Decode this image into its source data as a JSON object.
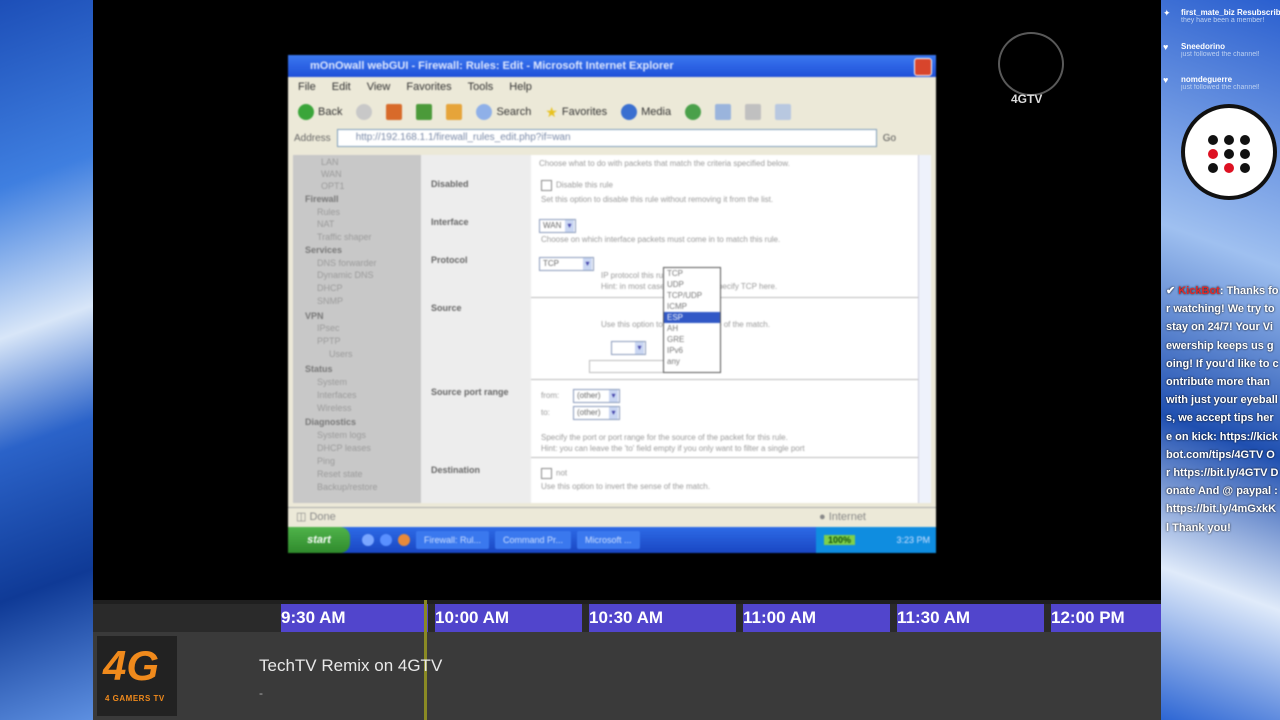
{
  "browser": {
    "title": "mOnOwall webGUI - Firewall: Rules: Edit - Microsoft Internet Explorer",
    "menu": [
      "File",
      "Edit",
      "View",
      "Favorites",
      "Tools",
      "Help"
    ],
    "toolbar": {
      "back": "Back",
      "search": "Search",
      "favorites": "Favorites",
      "media": "Media"
    },
    "address_label": "Address",
    "address": "http://192.168.1.1/firewall_rules_edit.php?if=wan",
    "go": "Go",
    "status_left": "Done",
    "status_right": "Internet"
  },
  "leftnav": {
    "items": [
      "LAN",
      "WAN",
      "OPT1",
      "Firewall",
      "Rules",
      "NAT",
      "Traffic shaper",
      "Services",
      "DNS forwarder",
      "Dynamic DNS",
      "DHCP",
      "SNMP",
      "VPN",
      "IPsec",
      "PPTP",
      "Users",
      "Status",
      "System",
      "Interfaces",
      "Wireless",
      "Diagnostics",
      "System logs",
      "DHCP leases",
      "Ping",
      "Reset state",
      "Backup/restore"
    ]
  },
  "form": {
    "intro": "Choose what to do with packets that match the criteria specified below.",
    "disabled_label": "Disabled",
    "disabled_check": "Disable this rule",
    "disabled_desc": "Set this option to disable this rule without removing it from the list.",
    "interface_label": "Interface",
    "interface_value": "WAN",
    "interface_desc": "Choose on which interface packets must come in to match this rule.",
    "protocol_label": "Protocol",
    "protocol_value": "TCP",
    "protocol_desc1": "IP protocol this rule should match.",
    "protocol_desc2": "Hint: in most cases, you should specify TCP here.",
    "protocol_options": [
      "TCP",
      "UDP",
      "TCP/UDP",
      "ICMP",
      "ESP",
      "AH",
      "GRE",
      "IPv6",
      "any"
    ],
    "protocol_highlight": 4,
    "source_label": "Source",
    "source_desc": "Use this option to invert the sense of the match.",
    "source_port_label": "Source port range",
    "from_label": "from:",
    "to_label": "to:",
    "port_value": "(other)",
    "port_desc1": "Specify the port or port range for the source of the packet for this rule.",
    "port_desc2": "Hint: you can leave the 'to' field empty if you only want to filter a single port",
    "destination_label": "Destination",
    "destination_check": "not",
    "destination_desc": "Use this option to invert the sense of the match."
  },
  "taskbar": {
    "start": "start",
    "tasks": [
      "Firewall: Rul...",
      "Command Pr...",
      "Microsoft ..."
    ],
    "tray_badge": "100%",
    "clock": "3:23 PM"
  },
  "watermark": "4GTV",
  "schedule": {
    "times": [
      "9:30 AM",
      "10:00 AM",
      "10:30 AM",
      "11:00 AM",
      "11:30 AM",
      "12:00 PM"
    ],
    "now_title": "TechTV Remix on 4GTV",
    "now_sub": "-",
    "logo_text": "4G",
    "logo_sub": "4 GAMERS TV"
  },
  "chat": {
    "events": [
      {
        "user": "first_mate_biz Resubscribed",
        "msg": "they have been a member!"
      },
      {
        "user": "Sneedorino",
        "msg": "just followed the channel!"
      },
      {
        "user": "nomdeguerre",
        "msg": "just followed the channel!"
      }
    ],
    "bot_name": "KickBot",
    "bot_message": "Thanks for watching! We try to stay on 24/7! Your Viewership keeps us going! If you'd like to contribute more than with just your eyeballs, we accept tips here on kick: https://kickbot.com/tips/4GTV Or https://bit.ly/4GTV Donate And @ paypal : https://bit.ly/4mGxkKl Thank you!"
  },
  "colors": {
    "slot": "#5145cc",
    "logo_orange": "#f08a1c",
    "bot_name": "#e02a2a"
  }
}
